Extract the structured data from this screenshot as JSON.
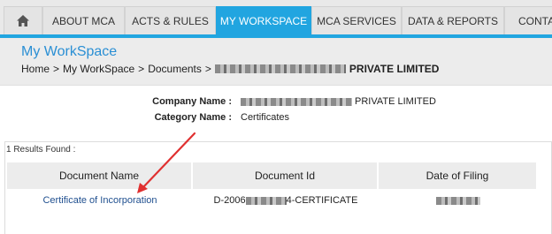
{
  "nav": {
    "home_icon": "home-icon",
    "items": [
      "ABOUT MCA",
      "ACTS & RULES",
      "MY WORKSPACE",
      "MCA SERVICES",
      "DATA & REPORTS",
      "CONTAC"
    ],
    "active": "MY WORKSPACE"
  },
  "header": {
    "title": "My WorkSpace",
    "breadcrumb": {
      "home": "Home",
      "sep": ">",
      "workspace": "My WorkSpace",
      "documents": "Documents",
      "company_suffix": "PRIVATE LIMITED"
    }
  },
  "company": {
    "name_label": "Company Name :",
    "name_suffix": "PRIVATE LIMITED",
    "category_label": "Category Name :",
    "category_value": "Certificates"
  },
  "results": {
    "count_text": "1 Results Found :",
    "columns": [
      "Document Name",
      "Document Id",
      "Date of Filing"
    ],
    "rows": [
      {
        "name": "Certificate of Incorporation",
        "id_prefix": "D-2006",
        "id_suffix": "4-CERTIFICATE"
      }
    ]
  },
  "colors": {
    "accent": "#21a5e0",
    "title": "#2a8fd4",
    "link": "#1f4f8f",
    "annotation": "#e03030"
  }
}
